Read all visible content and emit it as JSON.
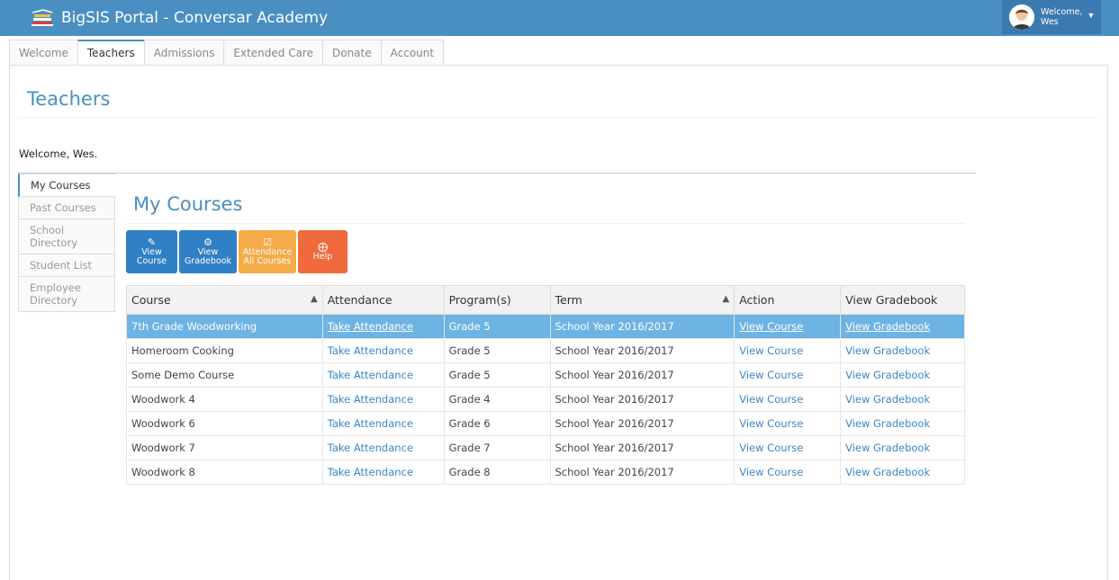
{
  "app": {
    "title": "BigSIS Portal - Conversar Academy",
    "user_greeting": "Welcome,",
    "user_name": "Wes"
  },
  "colors": {
    "topbar": "#4a8fc2",
    "accent": "#4a8fc2",
    "btn_blue": "#2f80c4",
    "btn_orange": "#f5ab48",
    "btn_red": "#f06a3b",
    "row_selected": "#6db3e3"
  },
  "tabs": [
    {
      "label": "Welcome",
      "active": false
    },
    {
      "label": "Teachers",
      "active": true
    },
    {
      "label": "Admissions",
      "active": false
    },
    {
      "label": "Extended Care",
      "active": false
    },
    {
      "label": "Donate",
      "active": false
    },
    {
      "label": "Account",
      "active": false
    }
  ],
  "page": {
    "title": "Teachers",
    "welcome": "Welcome, Wes."
  },
  "sidenav": [
    {
      "label": "My Courses",
      "active": true
    },
    {
      "label": "Past Courses",
      "active": false
    },
    {
      "label": "School Directory",
      "active": false
    },
    {
      "label": "Student List",
      "active": false
    },
    {
      "label": "Employee Directory",
      "active": false
    }
  ],
  "courses": {
    "title": "My Courses",
    "buttons": [
      {
        "icon": "edit-icon",
        "line1": "View",
        "line2": "Course",
        "color": "blue"
      },
      {
        "icon": "gear-icon",
        "line1": "View",
        "line2": "Gradebook",
        "color": "blue"
      },
      {
        "icon": "calendar-check-icon",
        "line1": "Attendance",
        "line2": "All Courses",
        "color": "orange"
      },
      {
        "icon": "lifebuoy-icon",
        "line1": "Help",
        "line2": "",
        "color": "red"
      }
    ],
    "columns": [
      "Course",
      "Attendance",
      "Program(s)",
      "Term",
      "Action",
      "View Gradebook"
    ],
    "rows": [
      {
        "course": "7th Grade Woodworking",
        "attendance": "Take Attendance",
        "program": "Grade 5",
        "term": "School Year 2016/2017",
        "action": "View Course",
        "gradebook": "View Gradebook",
        "selected": true
      },
      {
        "course": "Homeroom Cooking",
        "attendance": "Take Attendance",
        "program": "Grade 5",
        "term": "School Year 2016/2017",
        "action": "View Course",
        "gradebook": "View Gradebook",
        "selected": false
      },
      {
        "course": "Some Demo Course",
        "attendance": "Take Attendance",
        "program": "Grade 5",
        "term": "School Year 2016/2017",
        "action": "View Course",
        "gradebook": "View Gradebook",
        "selected": false
      },
      {
        "course": "Woodwork 4",
        "attendance": "Take Attendance",
        "program": "Grade 4",
        "term": "School Year 2016/2017",
        "action": "View Course",
        "gradebook": "View Gradebook",
        "selected": false
      },
      {
        "course": "Woodwork 6",
        "attendance": "Take Attendance",
        "program": "Grade 6",
        "term": "School Year 2016/2017",
        "action": "View Course",
        "gradebook": "View Gradebook",
        "selected": false
      },
      {
        "course": "Woodwork 7",
        "attendance": "Take Attendance",
        "program": "Grade 7",
        "term": "School Year 2016/2017",
        "action": "View Course",
        "gradebook": "View Gradebook",
        "selected": false
      },
      {
        "course": "Woodwork 8",
        "attendance": "Take Attendance",
        "program": "Grade 8",
        "term": "School Year 2016/2017",
        "action": "View Course",
        "gradebook": "View Gradebook",
        "selected": false
      }
    ]
  }
}
